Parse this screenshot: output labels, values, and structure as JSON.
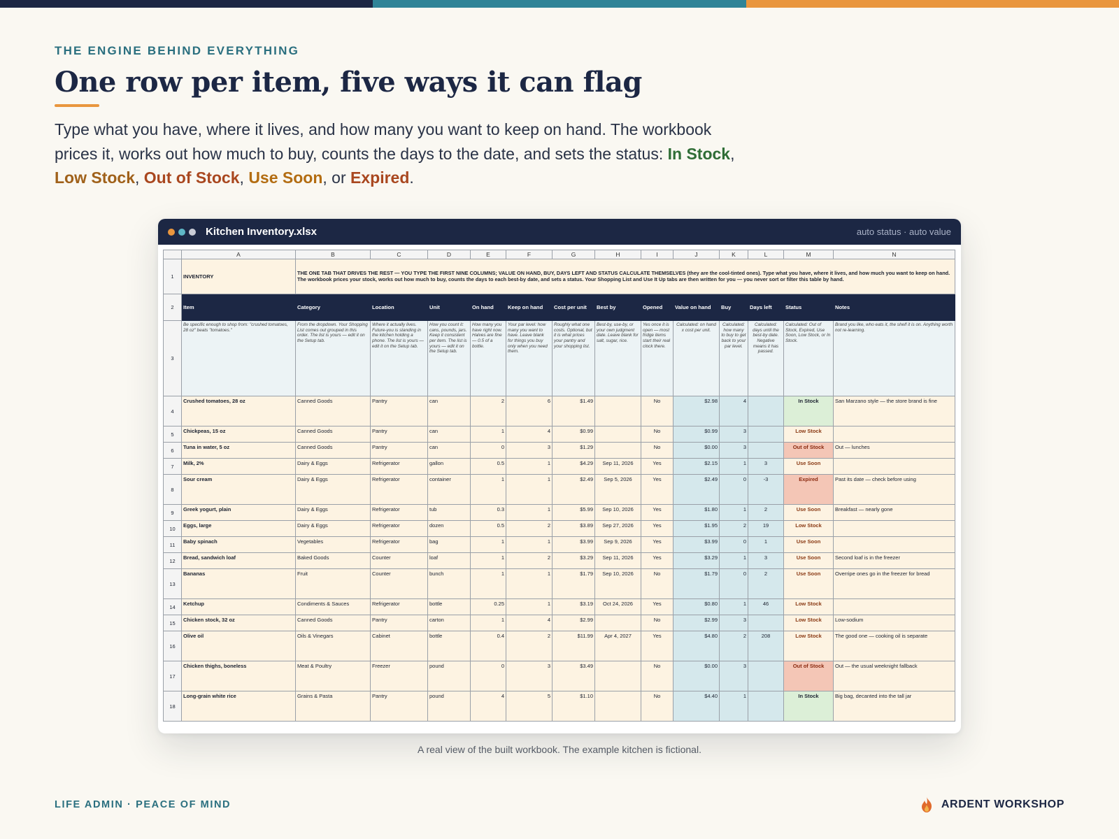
{
  "header": {
    "eyebrow": "THE ENGINE BEHIND EVERYTHING",
    "title": "One row per item, five ways it can flag",
    "lede_prefix": "Type what you have, where it lives, and how many you want to keep on hand. The workbook prices it, works out how much to buy, counts the days to the date, and sets the status: ",
    "statuses": [
      "In Stock",
      "Low Stock",
      "Out of Stock",
      "Use Soon",
      "Expired"
    ],
    "sep_comma": ", ",
    "sep_or": ", or ",
    "lede_suffix": "."
  },
  "window": {
    "title": "Kitchen Inventory.xlsx",
    "tag": "auto status · auto value"
  },
  "sheet": {
    "columns": [
      "A",
      "B",
      "C",
      "D",
      "E",
      "F",
      "G",
      "H",
      "I",
      "J",
      "K",
      "L",
      "M",
      "N"
    ],
    "row1_label": "INVENTORY",
    "row1_banner": "THE ONE TAB THAT DRIVES THE REST — YOU TYPE THE FIRST NINE COLUMNS; VALUE ON HAND, BUY, DAYS LEFT AND STATUS CALCULATE THEMSELVES (they are the cool-tinted ones). Type what you have, where it lives, and how much you want to keep on hand. The workbook prices your stock, works out how much to buy, counts the days to each best-by date, and sets a status. Your Shopping List and Use It Up tabs are then written for you — you never sort or filter this table by hand.",
    "headers": [
      "Item",
      "Category",
      "Location",
      "Unit",
      "On hand",
      "Keep on hand",
      "Cost per unit",
      "Best by",
      "Opened",
      "Value on hand",
      "Buy",
      "Days left",
      "Status",
      "Notes"
    ],
    "help": [
      "Be specific enough to shop from: \"crushed tomatoes, 28 oz\" beats \"tomatoes.\"",
      "From the dropdown. Your Shopping List comes out grouped in this order. The list is yours — edit it on the Setup tab.",
      "Where it actually lives. Future-you is standing in the kitchen holding a phone. The list is yours — edit it on the Setup tab.",
      "How you count it: cans, pounds, jars. Keep it consistent per item. The list is yours — edit it on the Setup tab.",
      "How many you have right now. Halves are fine — 0.5 of a bottle.",
      "Your par level: how many you want to have. Leave blank for things you buy only when you need them.",
      "Roughly what one costs. Optional, but it is what prices your pantry and your shopping list.",
      "Best-by, use-by, or your own judgment date. Leave blank for salt, sugar, rice.",
      "Yes once it is open — most fridge items start their real clock there.",
      "Calculated: on hand x cost per unit.",
      "Calculated: how many to buy to get back to your par level.",
      "Calculated: days until the best-by date. Negative means it has passed.",
      "Calculated: Out of Stock, Expired, Use Soon, Low Stock, or In Stock.",
      "Brand you like, who eats it, the shelf it is on. Anything worth not re-learning."
    ],
    "rows": [
      {
        "n": "4",
        "item": "Crushed tomatoes, 28 oz",
        "category": "Canned Goods",
        "location": "Pantry",
        "unit": "can",
        "on_hand": "2",
        "keep": "6",
        "cost": "$1.49",
        "best_by": "",
        "opened": "No",
        "value": "$2.98",
        "buy": "4",
        "days": "",
        "status": "In Stock",
        "status_key": "in",
        "notes": "San Marzano style — the store brand is fine",
        "h": 43
      },
      {
        "n": "5",
        "item": "Chickpeas, 15 oz",
        "category": "Canned Goods",
        "location": "Pantry",
        "unit": "can",
        "on_hand": "1",
        "keep": "4",
        "cost": "$0.99",
        "best_by": "",
        "opened": "No",
        "value": "$0.99",
        "buy": "3",
        "days": "",
        "status": "Low Stock",
        "status_key": "low",
        "notes": "",
        "h": 23
      },
      {
        "n": "6",
        "item": "Tuna in water, 5 oz",
        "category": "Canned Goods",
        "location": "Pantry",
        "unit": "can",
        "on_hand": "0",
        "keep": "3",
        "cost": "$1.29",
        "best_by": "",
        "opened": "No",
        "value": "$0.00",
        "buy": "3",
        "days": "",
        "status": "Out of Stock",
        "status_key": "out",
        "notes": "Out — lunches",
        "h": 23
      },
      {
        "n": "7",
        "item": "Milk, 2%",
        "category": "Dairy & Eggs",
        "location": "Refrigerator",
        "unit": "gallon",
        "on_hand": "0.5",
        "keep": "1",
        "cost": "$4.29",
        "best_by": "Sep 11, 2026",
        "opened": "Yes",
        "value": "$2.15",
        "buy": "1",
        "days": "3",
        "status": "Use Soon",
        "status_key": "soon",
        "notes": "",
        "h": 23
      },
      {
        "n": "8",
        "item": "Sour cream",
        "category": "Dairy & Eggs",
        "location": "Refrigerator",
        "unit": "container",
        "on_hand": "1",
        "keep": "1",
        "cost": "$2.49",
        "best_by": "Sep 5, 2026",
        "opened": "Yes",
        "value": "$2.49",
        "buy": "0",
        "days": "-3",
        "status": "Expired",
        "status_key": "exp",
        "notes": "Past its date — check before using",
        "h": 43
      },
      {
        "n": "9",
        "item": "Greek yogurt, plain",
        "category": "Dairy & Eggs",
        "location": "Refrigerator",
        "unit": "tub",
        "on_hand": "0.3",
        "keep": "1",
        "cost": "$5.99",
        "best_by": "Sep 10, 2026",
        "opened": "Yes",
        "value": "$1.80",
        "buy": "1",
        "days": "2",
        "status": "Use Soon",
        "status_key": "soon",
        "notes": "Breakfast — nearly gone",
        "h": 23
      },
      {
        "n": "10",
        "item": "Eggs, large",
        "category": "Dairy & Eggs",
        "location": "Refrigerator",
        "unit": "dozen",
        "on_hand": "0.5",
        "keep": "2",
        "cost": "$3.89",
        "best_by": "Sep 27, 2026",
        "opened": "Yes",
        "value": "$1.95",
        "buy": "2",
        "days": "19",
        "status": "Low Stock",
        "status_key": "low",
        "notes": "",
        "h": 23
      },
      {
        "n": "11",
        "item": "Baby spinach",
        "category": "Vegetables",
        "location": "Refrigerator",
        "unit": "bag",
        "on_hand": "1",
        "keep": "1",
        "cost": "$3.99",
        "best_by": "Sep 9, 2026",
        "opened": "Yes",
        "value": "$3.99",
        "buy": "0",
        "days": "1",
        "status": "Use Soon",
        "status_key": "soon",
        "notes": "",
        "h": 23
      },
      {
        "n": "12",
        "item": "Bread, sandwich loaf",
        "category": "Baked Goods",
        "location": "Counter",
        "unit": "loaf",
        "on_hand": "1",
        "keep": "2",
        "cost": "$3.29",
        "best_by": "Sep 11, 2026",
        "opened": "Yes",
        "value": "$3.29",
        "buy": "1",
        "days": "3",
        "status": "Use Soon",
        "status_key": "soon",
        "notes": "Second loaf is in the freezer",
        "h": 23
      },
      {
        "n": "13",
        "item": "Bananas",
        "category": "Fruit",
        "location": "Counter",
        "unit": "bunch",
        "on_hand": "1",
        "keep": "1",
        "cost": "$1.79",
        "best_by": "Sep 10, 2026",
        "opened": "No",
        "value": "$1.79",
        "buy": "0",
        "days": "2",
        "status": "Use Soon",
        "status_key": "soon",
        "notes": "Overripe ones go in the freezer for bread",
        "h": 43
      },
      {
        "n": "14",
        "item": "Ketchup",
        "category": "Condiments & Sauces",
        "location": "Refrigerator",
        "unit": "bottle",
        "on_hand": "0.25",
        "keep": "1",
        "cost": "$3.19",
        "best_by": "Oct 24, 2026",
        "opened": "Yes",
        "value": "$0.80",
        "buy": "1",
        "days": "46",
        "status": "Low Stock",
        "status_key": "low",
        "notes": "",
        "h": 23
      },
      {
        "n": "15",
        "item": "Chicken stock, 32 oz",
        "category": "Canned Goods",
        "location": "Pantry",
        "unit": "carton",
        "on_hand": "1",
        "keep": "4",
        "cost": "$2.99",
        "best_by": "",
        "opened": "No",
        "value": "$2.99",
        "buy": "3",
        "days": "",
        "status": "Low Stock",
        "status_key": "low",
        "notes": "Low-sodium",
        "h": 23
      },
      {
        "n": "16",
        "item": "Olive oil",
        "category": "Oils & Vinegars",
        "location": "Cabinet",
        "unit": "bottle",
        "on_hand": "0.4",
        "keep": "2",
        "cost": "$11.99",
        "best_by": "Apr 4, 2027",
        "opened": "Yes",
        "value": "$4.80",
        "buy": "2",
        "days": "208",
        "status": "Low Stock",
        "status_key": "low",
        "notes": "The good one — cooking oil is separate",
        "h": 43
      },
      {
        "n": "17",
        "item": "Chicken thighs, boneless",
        "category": "Meat & Poultry",
        "location": "Freezer",
        "unit": "pound",
        "on_hand": "0",
        "keep": "3",
        "cost": "$3.49",
        "best_by": "",
        "opened": "No",
        "value": "$0.00",
        "buy": "3",
        "days": "",
        "status": "Out of Stock",
        "status_key": "out",
        "notes": "Out — the usual weeknight fallback",
        "h": 43
      },
      {
        "n": "18",
        "item": "Long-grain white rice",
        "category": "Grains & Pasta",
        "location": "Pantry",
        "unit": "pound",
        "on_hand": "4",
        "keep": "5",
        "cost": "$1.10",
        "best_by": "",
        "opened": "No",
        "value": "$4.40",
        "buy": "1",
        "days": "",
        "status": "In Stock",
        "status_key": "in",
        "notes": "Big bag, decanted into the tall jar",
        "h": 43
      }
    ]
  },
  "caption": "A real view of the built workbook. The example kitchen is fictional.",
  "footer": {
    "left": "LIFE ADMIN · PEACE OF MIND",
    "brand": "ARDENT WORKSHOP",
    "brand_icon": "flame-icon"
  },
  "colors": {
    "navy": "#1c2744",
    "teal": "#2f8497",
    "orange": "#e9963e",
    "in_stock": "#2f6d36",
    "low_stock": "#a0611a",
    "out_of_stock": "#a9471f",
    "use_soon": "#b36d12",
    "expired": "#a9471f"
  }
}
